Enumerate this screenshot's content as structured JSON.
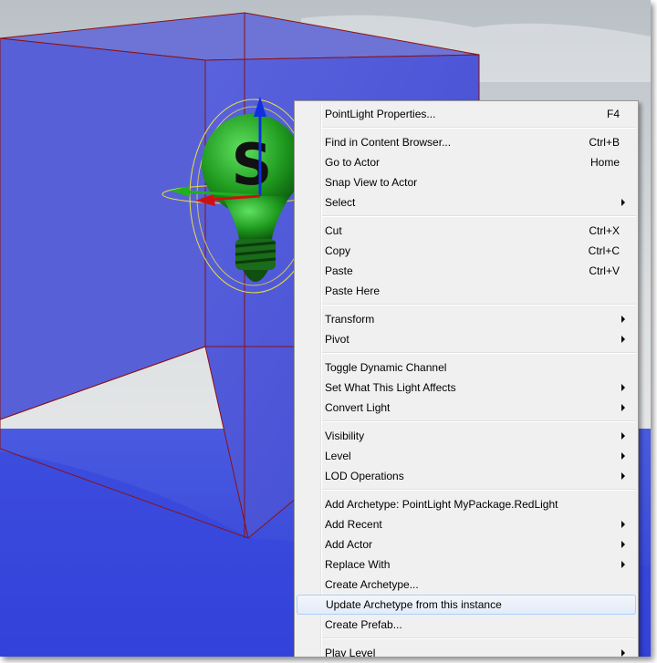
{
  "menu": {
    "groups": [
      [
        {
          "label": "PointLight Properties...",
          "shortcut": "F4",
          "submenu": false
        }
      ],
      [
        {
          "label": "Find in Content Browser...",
          "shortcut": "Ctrl+B",
          "submenu": false
        },
        {
          "label": "Go to Actor",
          "shortcut": "Home",
          "submenu": false
        },
        {
          "label": "Snap View to Actor",
          "shortcut": "",
          "submenu": false
        },
        {
          "label": "Select",
          "shortcut": "",
          "submenu": true
        }
      ],
      [
        {
          "label": "Cut",
          "shortcut": "Ctrl+X",
          "submenu": false
        },
        {
          "label": "Copy",
          "shortcut": "Ctrl+C",
          "submenu": false
        },
        {
          "label": "Paste",
          "shortcut": "Ctrl+V",
          "submenu": false
        },
        {
          "label": "Paste Here",
          "shortcut": "",
          "submenu": false
        }
      ],
      [
        {
          "label": "Transform",
          "shortcut": "",
          "submenu": true
        },
        {
          "label": "Pivot",
          "shortcut": "",
          "submenu": true
        }
      ],
      [
        {
          "label": "Toggle Dynamic Channel",
          "shortcut": "",
          "submenu": false
        },
        {
          "label": "Set What This Light Affects",
          "shortcut": "",
          "submenu": true
        },
        {
          "label": "Convert Light",
          "shortcut": "",
          "submenu": true
        }
      ],
      [
        {
          "label": "Visibility",
          "shortcut": "",
          "submenu": true
        },
        {
          "label": "Level",
          "shortcut": "",
          "submenu": true
        },
        {
          "label": "LOD Operations",
          "shortcut": "",
          "submenu": true
        }
      ],
      [
        {
          "label": "Add Archetype: PointLight MyPackage.RedLight",
          "shortcut": "",
          "submenu": false
        },
        {
          "label": "Add Recent",
          "shortcut": "",
          "submenu": true
        },
        {
          "label": "Add Actor",
          "shortcut": "",
          "submenu": true
        },
        {
          "label": "Replace With",
          "shortcut": "",
          "submenu": true
        },
        {
          "label": "Create Archetype...",
          "shortcut": "",
          "submenu": false
        },
        {
          "label": "Update Archetype from this instance",
          "shortcut": "",
          "submenu": false,
          "highlighted": true
        },
        {
          "label": "Create Prefab...",
          "shortcut": "",
          "submenu": false
        }
      ],
      [
        {
          "label": "Play Level",
          "shortcut": "",
          "submenu": true
        }
      ]
    ]
  },
  "viewport": {
    "icon": "point-light-icon",
    "glyph": "S",
    "colors": {
      "cube": "#4a52d8",
      "floor": "#3848d8",
      "bulb": "#1f9a1f",
      "wire": "#8c1010",
      "gizmo_ring": "#e8e040"
    }
  }
}
